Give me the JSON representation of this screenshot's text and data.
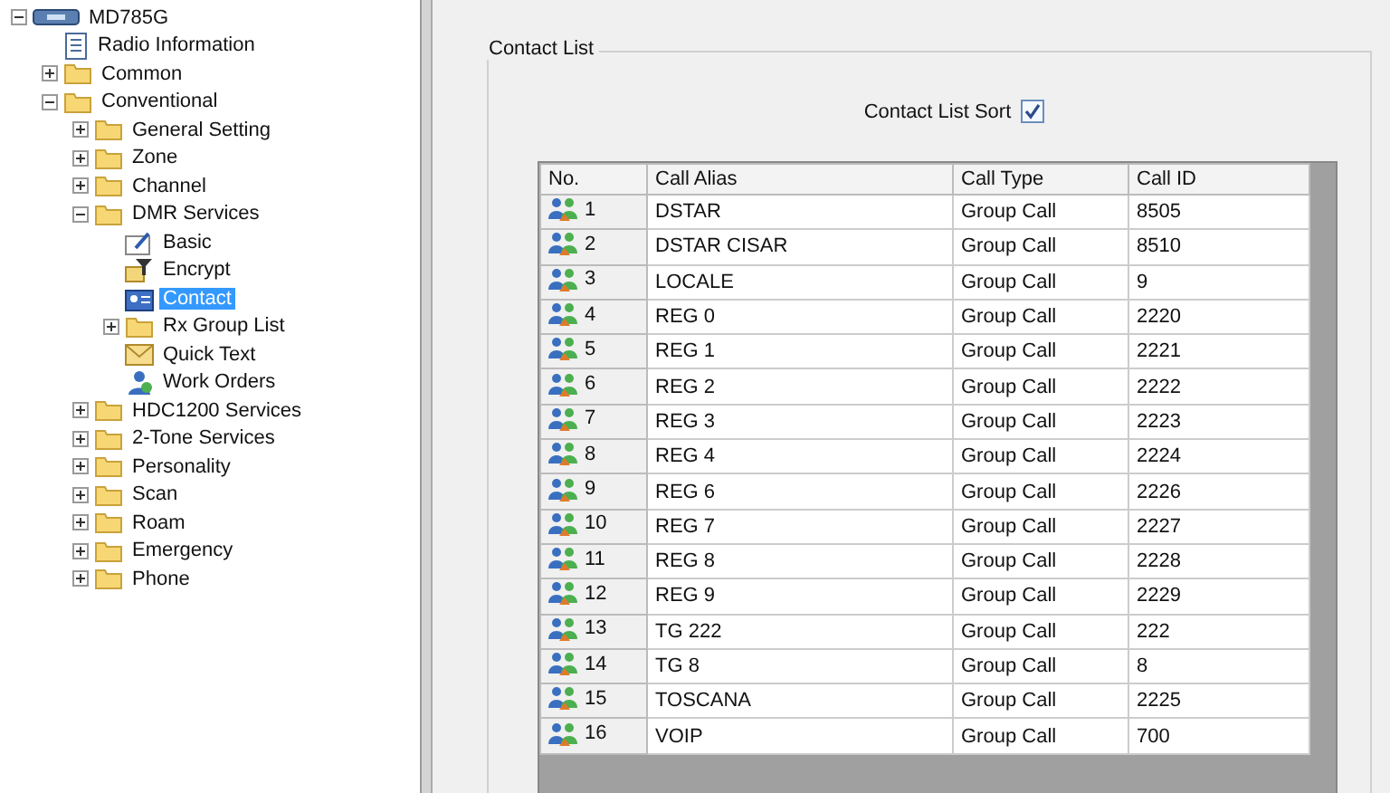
{
  "tree": [
    {
      "label": "MD785G",
      "kind": "radio",
      "expanded": true,
      "selected": false,
      "children": [
        {
          "label": "Radio Information",
          "kind": "doc",
          "selected": false
        },
        {
          "label": "Common",
          "kind": "folder",
          "expanded": false,
          "selected": false
        },
        {
          "label": "Conventional",
          "kind": "folder",
          "expanded": true,
          "selected": false,
          "children": [
            {
              "label": "General Setting",
              "kind": "folder",
              "expanded": false,
              "selected": false
            },
            {
              "label": "Zone",
              "kind": "folder",
              "expanded": false,
              "selected": false
            },
            {
              "label": "Channel",
              "kind": "folder",
              "expanded": false,
              "selected": false
            },
            {
              "label": "DMR Services",
              "kind": "folder",
              "expanded": true,
              "selected": false,
              "children": [
                {
                  "label": "Basic",
                  "kind": "basic",
                  "selected": false
                },
                {
                  "label": "Encrypt",
                  "kind": "encrypt",
                  "selected": false
                },
                {
                  "label": "Contact",
                  "kind": "contact",
                  "selected": true
                },
                {
                  "label": "Rx Group List",
                  "kind": "folder",
                  "expanded": false,
                  "selected": false
                },
                {
                  "label": "Quick Text",
                  "kind": "envelope",
                  "selected": false
                },
                {
                  "label": "Work Orders",
                  "kind": "people",
                  "selected": false
                }
              ]
            },
            {
              "label": "HDC1200 Services",
              "kind": "folder",
              "expanded": false,
              "selected": false
            },
            {
              "label": "2-Tone Services",
              "kind": "folder",
              "expanded": false,
              "selected": false
            },
            {
              "label": "Personality",
              "kind": "folder",
              "expanded": false,
              "selected": false
            },
            {
              "label": "Scan",
              "kind": "folder",
              "expanded": false,
              "selected": false
            },
            {
              "label": "Roam",
              "kind": "folder",
              "expanded": false,
              "selected": false
            },
            {
              "label": "Emergency",
              "kind": "folder",
              "expanded": false,
              "selected": false
            },
            {
              "label": "Phone",
              "kind": "folder",
              "expanded": false,
              "selected": false
            }
          ]
        }
      ]
    }
  ],
  "group_title": "Contact List",
  "sort": {
    "label": "Contact List Sort",
    "checked": true
  },
  "table": {
    "columns": [
      "No.",
      "Call Alias",
      "Call Type",
      "Call ID"
    ],
    "rows": [
      [
        "1",
        "DSTAR",
        "Group Call",
        "8505"
      ],
      [
        "2",
        "DSTAR CISAR",
        "Group Call",
        "8510"
      ],
      [
        "3",
        "LOCALE",
        "Group Call",
        "9"
      ],
      [
        "4",
        "REG 0",
        "Group Call",
        "2220"
      ],
      [
        "5",
        "REG 1",
        "Group Call",
        "2221"
      ],
      [
        "6",
        "REG 2",
        "Group Call",
        "2222"
      ],
      [
        "7",
        "REG 3",
        "Group Call",
        "2223"
      ],
      [
        "8",
        "REG 4",
        "Group Call",
        "2224"
      ],
      [
        "9",
        "REG 6",
        "Group Call",
        "2226"
      ],
      [
        "10",
        "REG 7",
        "Group Call",
        "2227"
      ],
      [
        "11",
        "REG 8",
        "Group Call",
        "2228"
      ],
      [
        "12",
        "REG 9",
        "Group Call",
        "2229"
      ],
      [
        "13",
        "TG 222",
        "Group Call",
        "222"
      ],
      [
        "14",
        "TG 8",
        "Group Call",
        "8"
      ],
      [
        "15",
        "TOSCANA",
        "Group Call",
        "2225"
      ],
      [
        "16",
        "VOIP",
        "Group Call",
        "700"
      ]
    ]
  }
}
